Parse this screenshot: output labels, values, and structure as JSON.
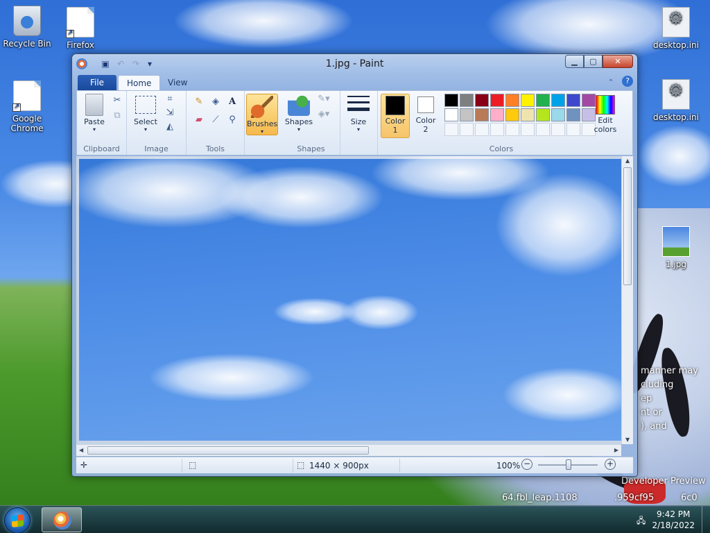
{
  "desktop": {
    "icons": [
      {
        "name": "recycle-bin",
        "label": "Recycle Bin"
      },
      {
        "name": "firefox",
        "label": "Firefox"
      },
      {
        "name": "google-chrome",
        "label": "Google Chrome"
      },
      {
        "name": "desktop-ini-1",
        "label": "desktop.ini"
      },
      {
        "name": "desktop-ini-2",
        "label": "desktop.ini"
      },
      {
        "name": "image-1jpg",
        "label": "1.jpg"
      }
    ],
    "overlay_text": [
      "manner may",
      "cluding",
      "ep",
      "nt or",
      "), and",
      "Developer Preview",
      "64.fbl_leap.1108",
      ".959cf95",
      "6c0"
    ]
  },
  "window": {
    "title": "1.jpg - Paint",
    "tabs": {
      "file": "File",
      "home": "Home",
      "view": "View"
    },
    "groups": {
      "clipboard": "Clipboard",
      "image": "Image",
      "tools": "Tools",
      "shapes": "Shapes",
      "colors": "Colors"
    },
    "buttons": {
      "paste": "Paste",
      "select": "Select",
      "brushes": "Brushes",
      "shapes": "Shapes",
      "size": "Size",
      "color1": "Color",
      "color1_num": "1",
      "color2": "Color",
      "color2_num": "2",
      "edit_colors_1": "Edit",
      "edit_colors_2": "colors"
    },
    "palette_row1": [
      "#000000",
      "#7f7f7f",
      "#880015",
      "#ed1c24",
      "#ff7f27",
      "#fff200",
      "#22b14c",
      "#00a2e8",
      "#3f48cc",
      "#a349a4"
    ],
    "palette_row2": [
      "#ffffff",
      "#c3c3c3",
      "#b97a57",
      "#ffaec9",
      "#ffc90e",
      "#efe4b0",
      "#b5e61d",
      "#99d9ea",
      "#7092be",
      "#c8bfe7"
    ],
    "status": {
      "dimensions": "1440 × 900px",
      "zoom": "100%"
    }
  },
  "taskbar": {
    "time": "9:42 PM",
    "date": "2/18/2022"
  }
}
